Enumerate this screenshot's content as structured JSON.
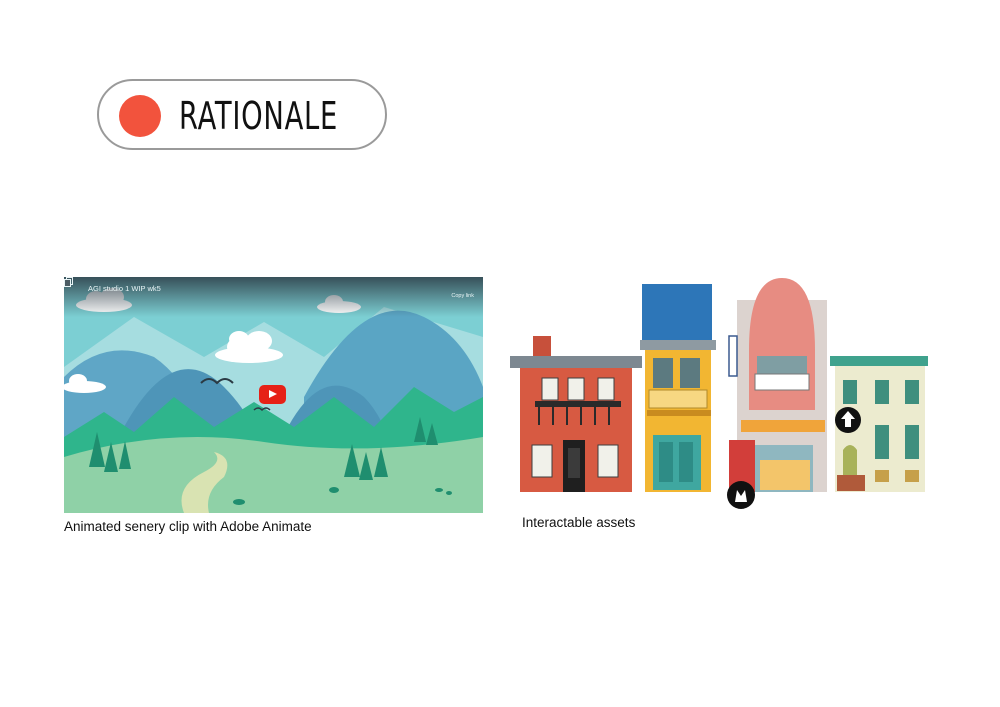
{
  "title": {
    "text": "RATIONALE",
    "accent": "#f2533d"
  },
  "video": {
    "title": "AGI studio 1 WIP wk5",
    "copy_label": "Copy link",
    "icons": [
      "copy-icon",
      "youtube-play-icon"
    ]
  },
  "captions": {
    "video": "Animated senery clip with Adobe Animate",
    "assets": "Interactable assets"
  },
  "colors": {
    "sky": "#7ccfd3",
    "mountain": "#5fa6c6",
    "hill": "#3bb98a",
    "brick_house": "#d75a42",
    "yellow_house": "#f2b632",
    "pink_shop": "#e78c82",
    "cream_house": "#ecebcf"
  }
}
